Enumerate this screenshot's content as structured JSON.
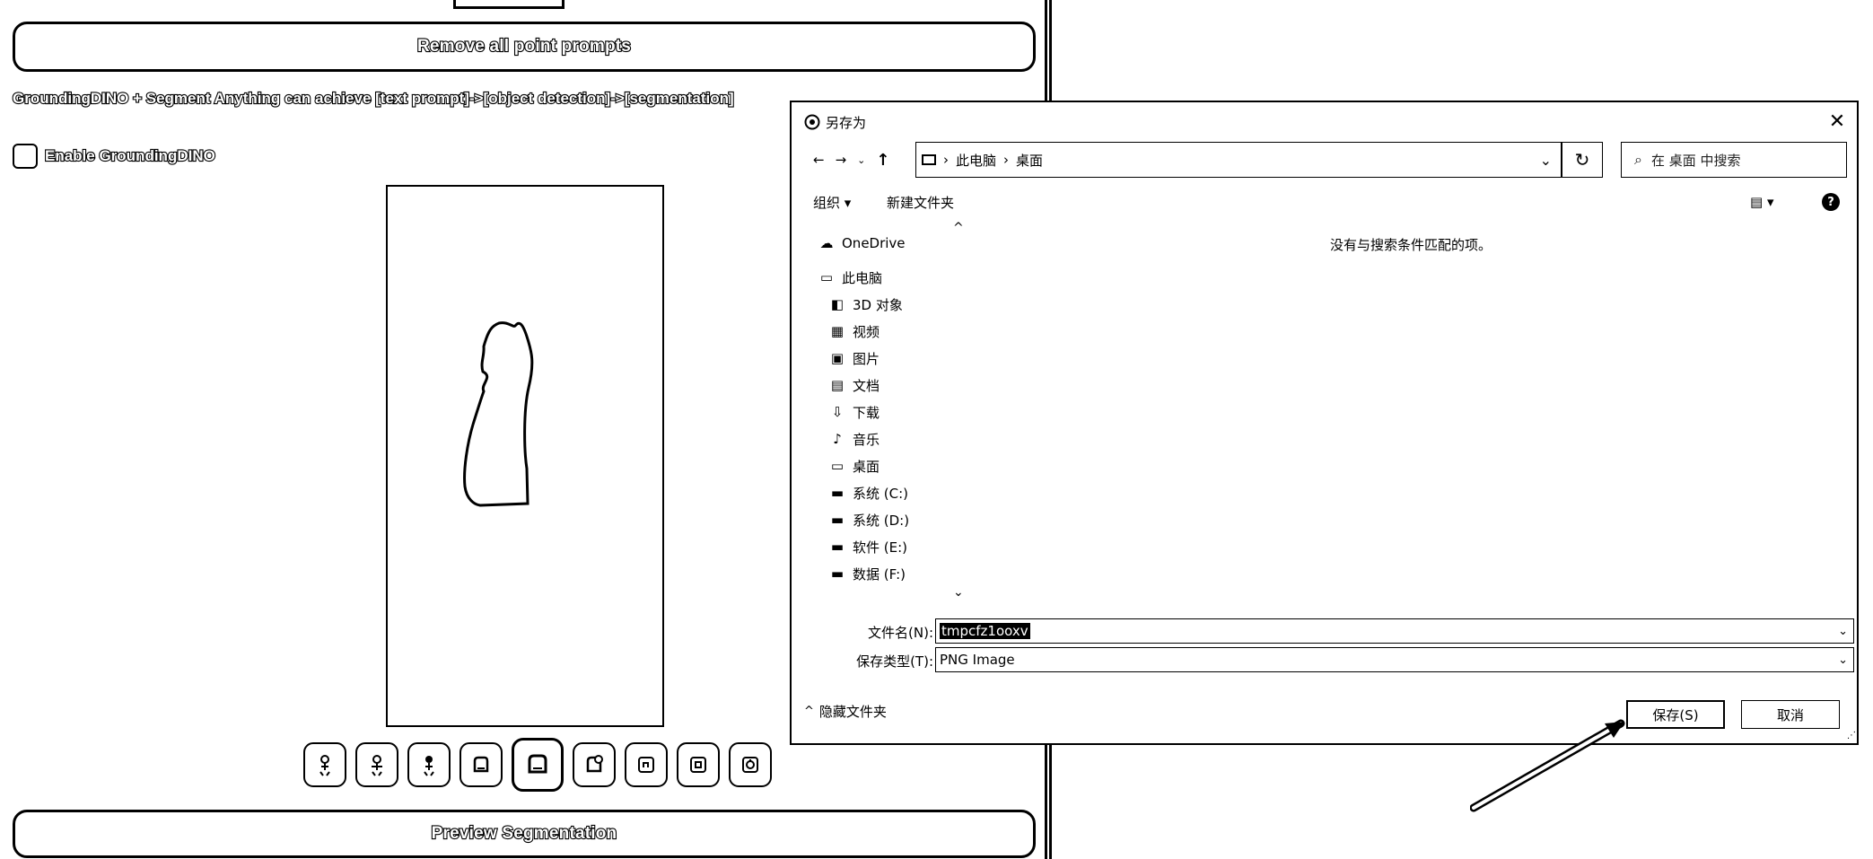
{
  "left_panel": {
    "remove_prompts_label": "Remove all point prompts",
    "grounding_description": "GroundingDINO + Segment Anything can achieve [text prompt]->[object detection]->[segmentation]",
    "enable_grounding_label": "Enable GroundingDINO",
    "enable_grounding_checked": false,
    "preview_label": "Preview Segmentation",
    "tools": [
      {
        "icon": "point-add-icon"
      },
      {
        "icon": "point-remove-icon"
      },
      {
        "icon": "point-clear-icon"
      },
      {
        "icon": "box-icon"
      },
      {
        "icon": "box-active-icon",
        "active": true
      },
      {
        "icon": "box-add-icon"
      },
      {
        "icon": "crop-icon"
      },
      {
        "icon": "crop-alt-icon"
      },
      {
        "icon": "reset-icon"
      }
    ]
  },
  "dialog": {
    "title": "另存为",
    "breadcrumb": [
      "此电脑",
      "桌面"
    ],
    "search_placeholder": "在 桌面 中搜索",
    "toolbar": {
      "organize": "组织 ▾",
      "new_folder": "新建文件夹"
    },
    "nav_items": [
      {
        "icon": "cloud-icon",
        "label": "OneDrive",
        "indent": false
      },
      {
        "icon": "computer-icon",
        "label": "此电脑",
        "indent": false
      },
      {
        "icon": "cube-3d-icon",
        "label": "3D 对象",
        "indent": true
      },
      {
        "icon": "video-icon",
        "label": "视频",
        "indent": true
      },
      {
        "icon": "picture-icon",
        "label": "图片",
        "indent": true
      },
      {
        "icon": "document-icon",
        "label": "文档",
        "indent": true
      },
      {
        "icon": "download-icon",
        "label": "下载",
        "indent": true
      },
      {
        "icon": "music-icon",
        "label": "音乐",
        "indent": true
      },
      {
        "icon": "desktop-icon",
        "label": "桌面",
        "indent": true
      },
      {
        "icon": "drive-icon",
        "label": "系统 (C:)",
        "indent": true
      },
      {
        "icon": "drive-icon",
        "label": "系统 (D:)",
        "indent": true
      },
      {
        "icon": "drive-icon",
        "label": "软件 (E:)",
        "indent": true
      },
      {
        "icon": "drive-icon",
        "label": "数据 (F:)",
        "indent": true
      }
    ],
    "empty_message": "没有与搜索条件匹配的项。",
    "filename_label": "文件名(N):",
    "filename_value": "tmpcfz1ooxv",
    "filetype_label": "保存类型(T):",
    "filetype_value": "PNG Image",
    "hide_folders_label": "隐藏文件夹",
    "save_label": "保存(S)",
    "cancel_label": "取消"
  }
}
